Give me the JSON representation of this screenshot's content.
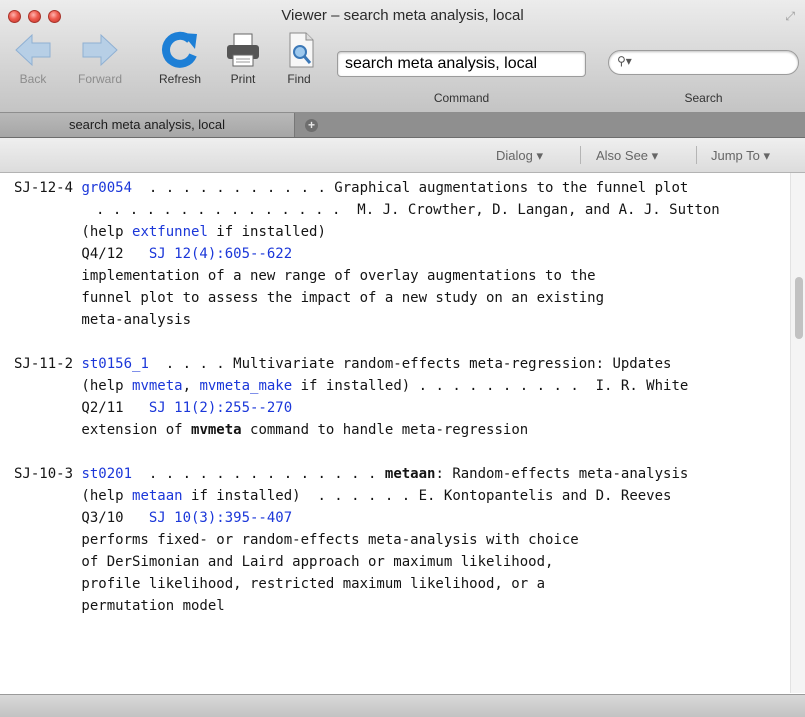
{
  "window": {
    "title": "Viewer – search meta analysis, local"
  },
  "toolbar": {
    "back_label": "Back",
    "forward_label": "Forward",
    "refresh_label": "Refresh",
    "print_label": "Print",
    "find_label": "Find",
    "command_value": "search meta analysis, local",
    "command_label": "Command",
    "search_value": "",
    "search_label": "Search"
  },
  "tabs": [
    {
      "label": "search meta analysis, local"
    }
  ],
  "subtoolbar": {
    "dialog": "Dialog ▾",
    "also_see": "Also See ▾",
    "jump_to": "Jump To ▾"
  },
  "results": [
    {
      "lines": [
        {
          "seg": [
            "SJ-12-4 ",
            "gr0054",
            "  . . . . . . . . . . . Graphical augmentations to the funnel plot"
          ]
        },
        {
          "seg": [
            ". . . . . . . . . . . . . . .  M. J. Crowther, D. Langan, and A. J. Sutton"
          ]
        },
        {
          "seg": [
            "        (help ",
            "extfunnel",
            " if installed)"
          ]
        },
        {
          "seg": [
            "        Q4/12   ",
            "SJ 12(4):605--622"
          ]
        },
        {
          "seg": [
            "        implementation of a new range of overlay augmentations to the"
          ]
        },
        {
          "seg": [
            "        funnel plot to assess the impact of a new study on an existing"
          ]
        },
        {
          "seg": [
            "        meta-analysis"
          ]
        }
      ]
    },
    {
      "lines": [
        {
          "seg": [
            "SJ-11-2 ",
            "st0156_1",
            "  . . . . Multivariate random-effects meta-regression: Updates"
          ]
        },
        {
          "seg": [
            "        (help ",
            "mvmeta",
            ", ",
            "mvmeta_make",
            " if installed) . . . . . . . . . .  I. R. White"
          ]
        },
        {
          "seg": [
            "        Q2/11   ",
            "SJ 11(2):255--270"
          ]
        },
        {
          "seg": [
            "        extension of ",
            "mvmeta",
            " command to handle meta-regression"
          ]
        }
      ]
    },
    {
      "lines": [
        {
          "seg": [
            "SJ-10-3 ",
            "st0201",
            "  . . . . . . . . . . . . . . ",
            "metaan",
            ": Random-effects meta-analysis"
          ]
        },
        {
          "seg": [
            "        (help ",
            "metaan",
            " if installed)  . . . . . . E. Kontopantelis and D. Reeves"
          ]
        },
        {
          "seg": [
            "        Q3/10   ",
            "SJ 10(3):395--407"
          ]
        },
        {
          "seg": [
            "        performs fixed- or random-effects meta-analysis with choice"
          ]
        },
        {
          "seg": [
            "        of DerSimonian and Laird approach or maximum likelihood,"
          ]
        },
        {
          "seg": [
            "        profile likelihood, restricted maximum likelihood, or a"
          ]
        },
        {
          "seg": [
            "        permutation model"
          ]
        }
      ]
    }
  ],
  "colors": {
    "link": "#1b37d9",
    "tabbar": "#8f8f8f"
  }
}
